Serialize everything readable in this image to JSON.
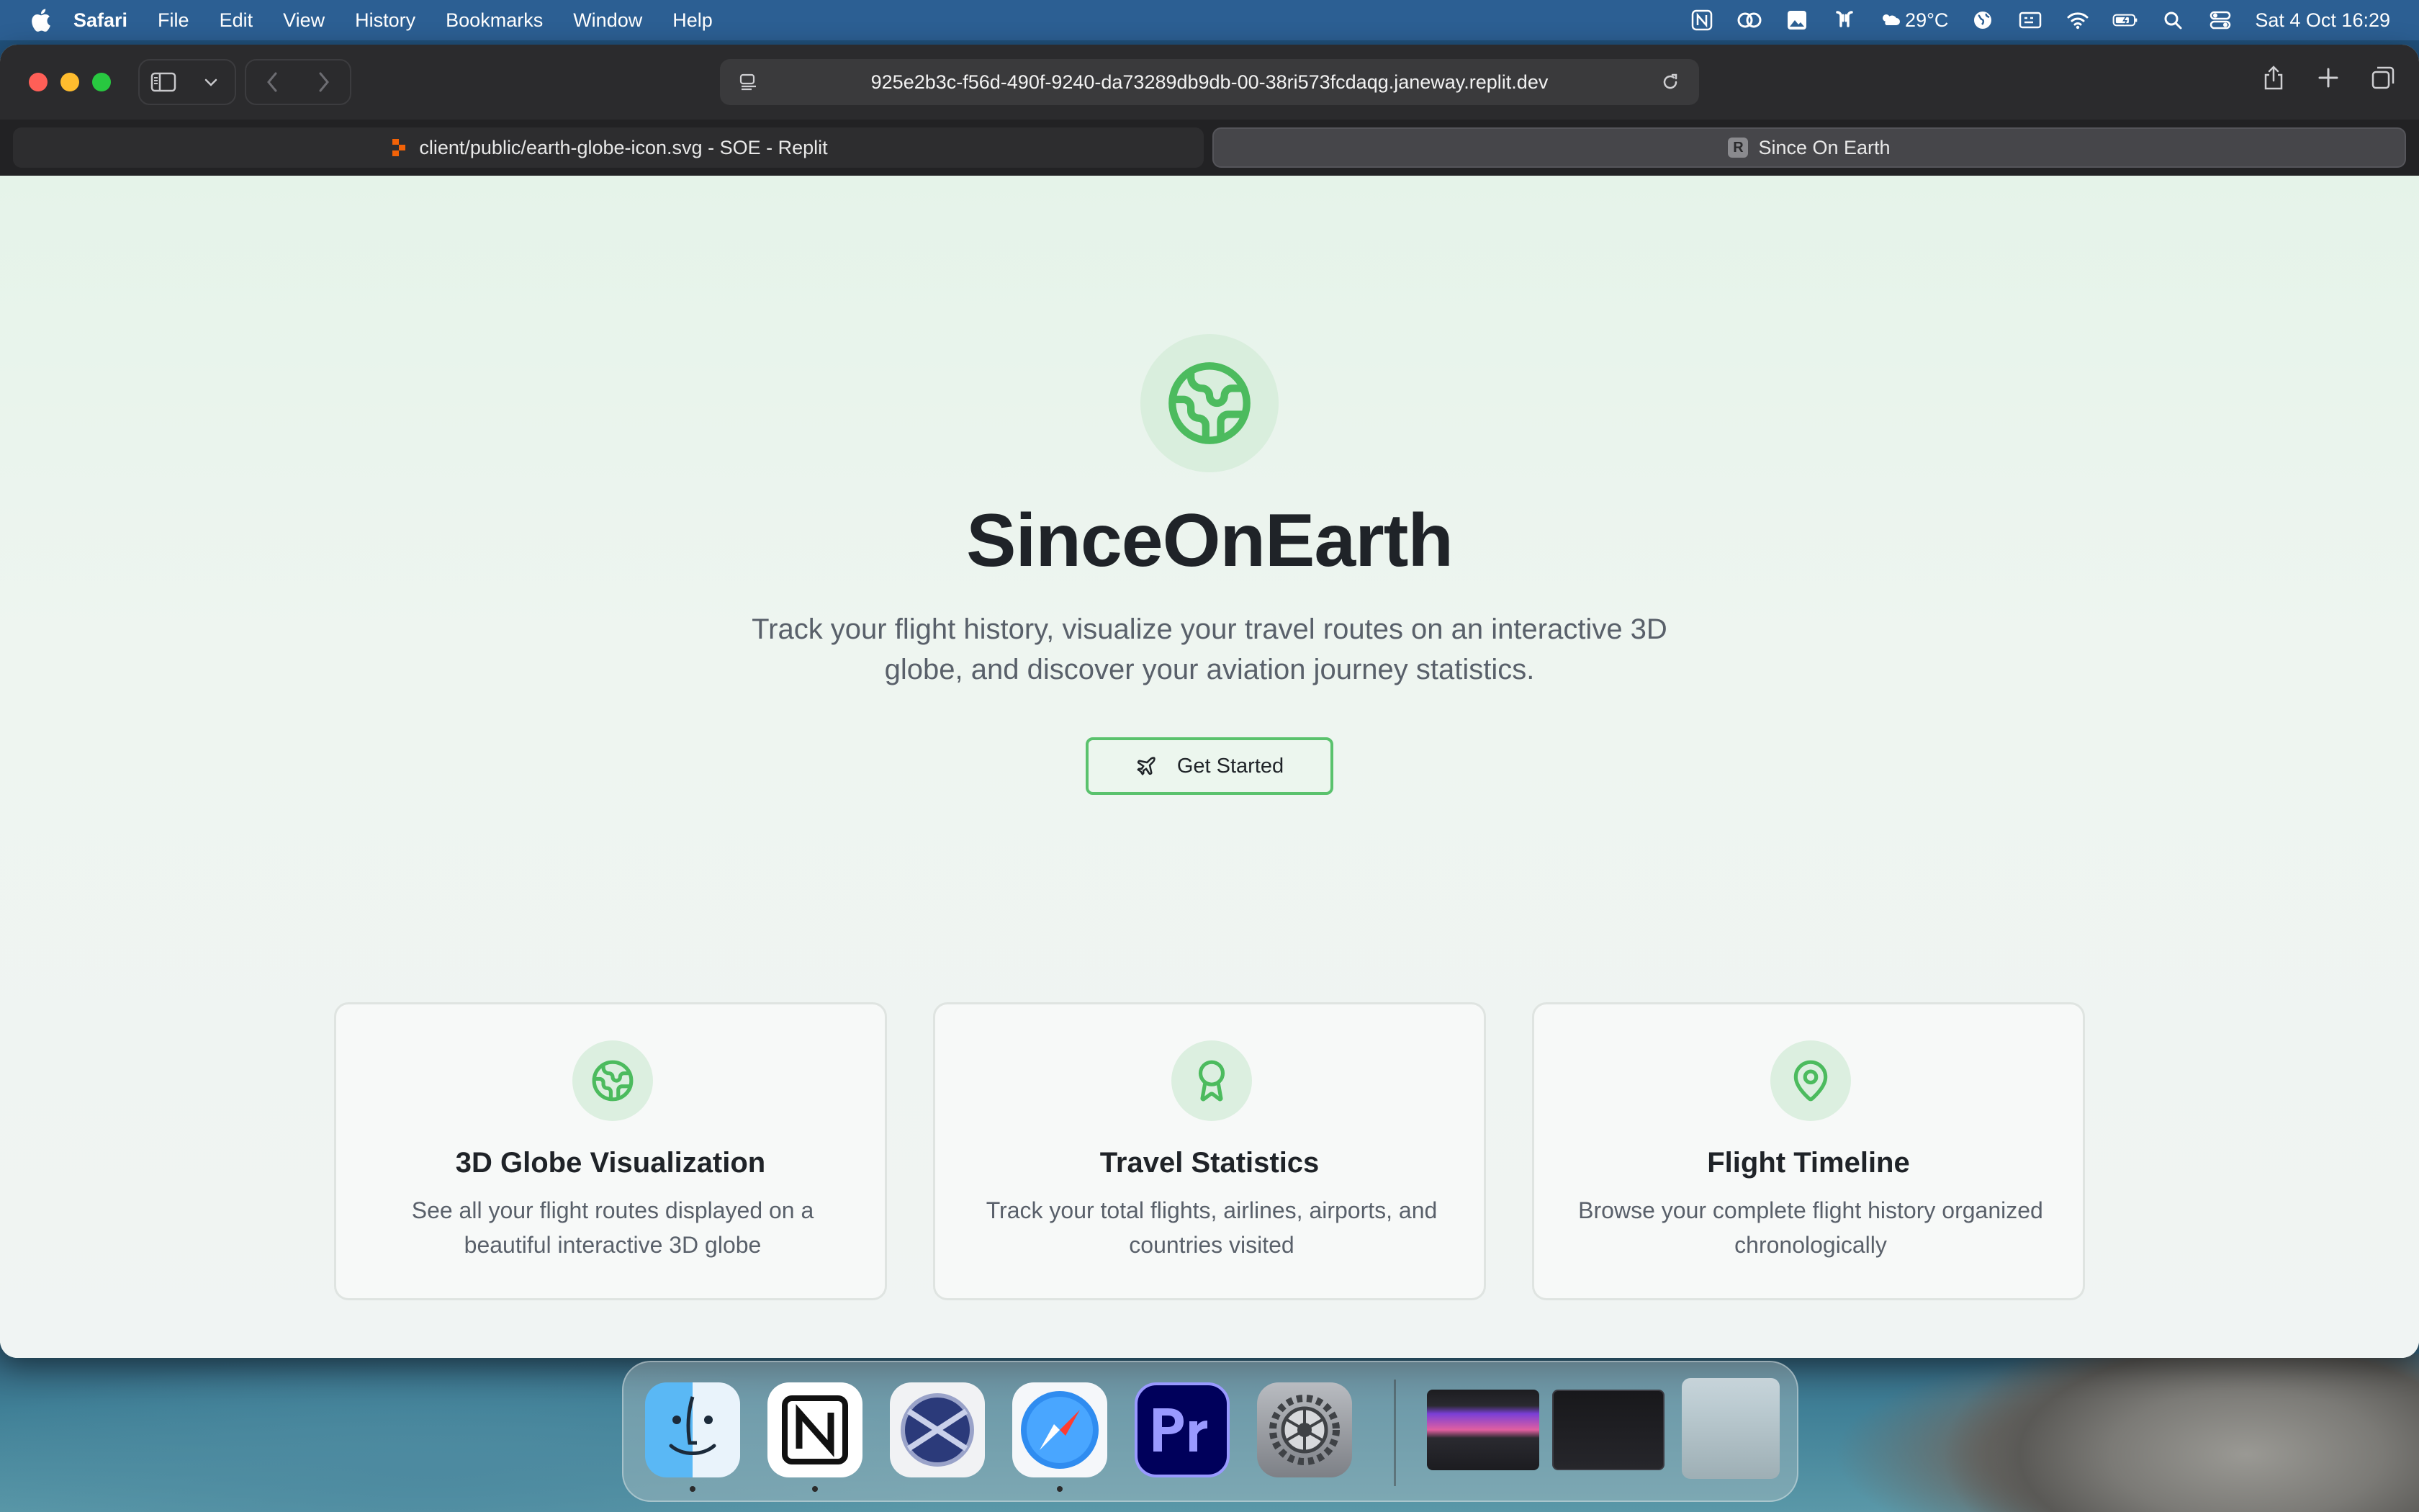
{
  "menubar": {
    "app_name": "Safari",
    "menus": [
      "File",
      "Edit",
      "View",
      "History",
      "Bookmarks",
      "Window",
      "Help"
    ],
    "weather": "29°C",
    "datetime": "Sat 4 Oct  16:29"
  },
  "browser": {
    "url": "925e2b3c-f56d-490f-9240-da73289db9db-00-38ri573fcdaqg.janeway.replit.dev",
    "tabs": [
      {
        "label": "client/public/earth-globe-icon.svg - SOE - Replit",
        "active": false
      },
      {
        "label": "Since On Earth",
        "active": true,
        "favicon_letter": "R"
      }
    ]
  },
  "hero": {
    "title": "SinceOnEarth",
    "subtitle": "Track your flight history, visualize your travel routes on an interactive 3D globe, and discover your aviation journey statistics.",
    "cta_label": "Get Started"
  },
  "features": [
    {
      "icon": "globe-icon",
      "title": "3D Globe Visualization",
      "description": "See all your flight routes displayed on a beautiful interactive 3D globe"
    },
    {
      "icon": "award-icon",
      "title": "Travel Statistics",
      "description": "Track your total flights, airlines, airports, and countries visited"
    },
    {
      "icon": "map-pin-icon",
      "title": "Flight Timeline",
      "description": "Browse your complete flight history organized chronologically"
    }
  ],
  "colors": {
    "accent": "#5ac26d",
    "menubar": "#2c5f93",
    "browser_chrome": "#2b2b2d",
    "page_bg": "#eef5f0"
  },
  "dock": {
    "apps": [
      "Finder",
      "Notion",
      "Xcode-like",
      "Safari",
      "Premiere Pro",
      "System Settings"
    ]
  }
}
